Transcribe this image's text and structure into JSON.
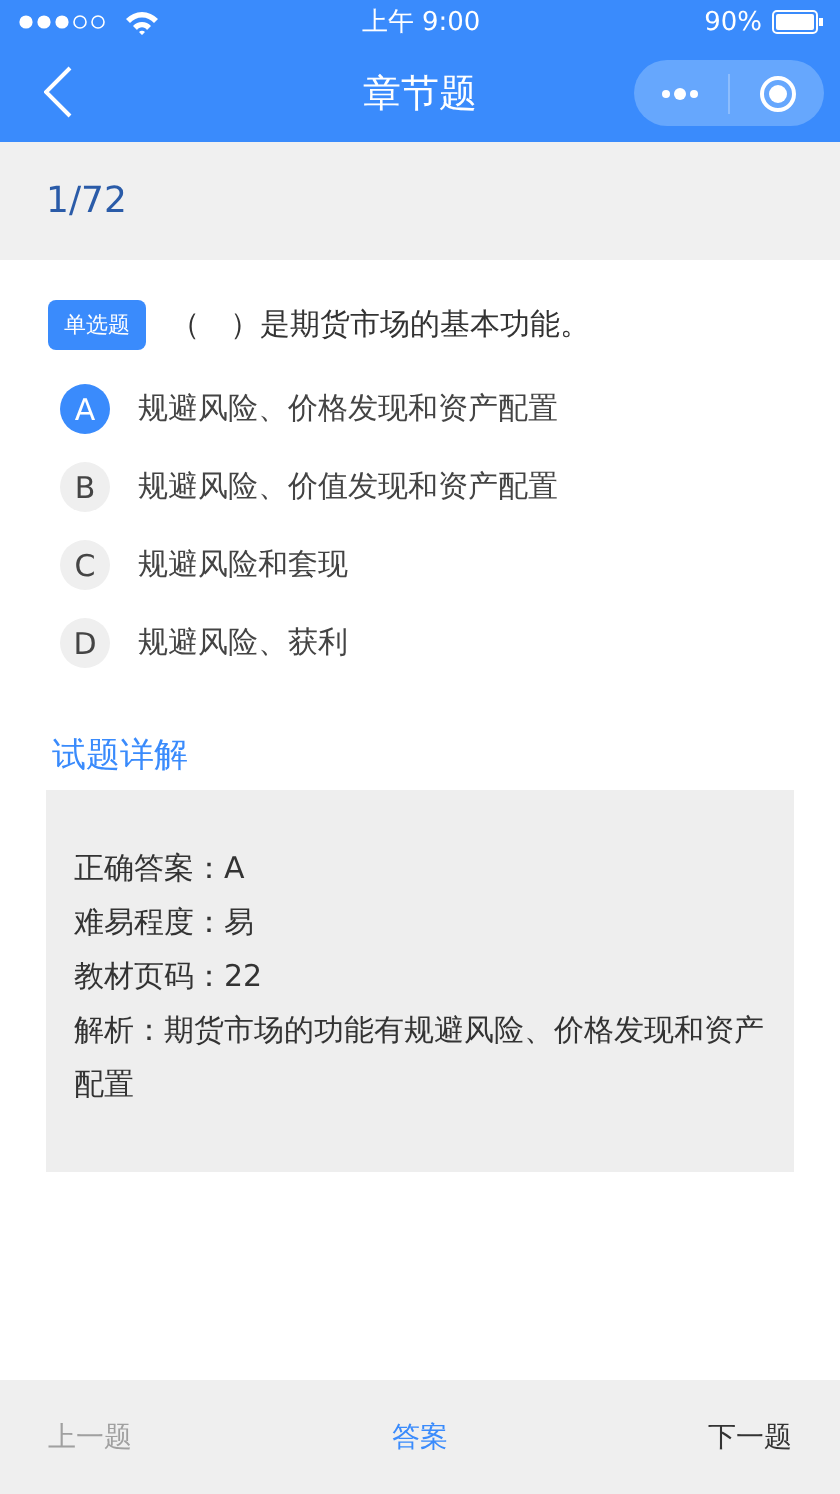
{
  "status_bar": {
    "time": "上午 9:00",
    "battery": "90%"
  },
  "nav": {
    "title": "章节题"
  },
  "progress": "1/72",
  "question": {
    "type_badge": "单选题",
    "text": "（　）是期货市场的基本功能。"
  },
  "options": [
    {
      "letter": "A",
      "text": "规避风险、价格发现和资产配置",
      "selected": true
    },
    {
      "letter": "B",
      "text": "规避风险、价值发现和资产配置",
      "selected": false
    },
    {
      "letter": "C",
      "text": "规避风险和套现",
      "selected": false
    },
    {
      "letter": "D",
      "text": "规避风险、获利",
      "selected": false
    }
  ],
  "explanation": {
    "title": "试题详解",
    "lines": [
      "正确答案：A",
      "难易程度：易",
      "教材页码：22",
      "解析：期货市场的功能有规避风险、价格发现和资产配置"
    ]
  },
  "bottom_bar": [
    {
      "label": "上一题",
      "selected": false,
      "disabled": true
    },
    {
      "label": "答案",
      "selected": true,
      "disabled": false
    },
    {
      "label": "下一题",
      "selected": false,
      "disabled": false
    }
  ]
}
